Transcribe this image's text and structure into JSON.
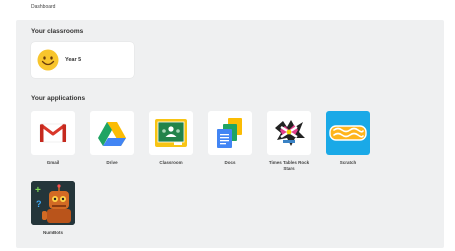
{
  "header": {
    "title": "Dashboard"
  },
  "classrooms": {
    "heading": "Your classrooms",
    "items": [
      {
        "label": "Year 5",
        "icon": "smiley-emoji-icon"
      }
    ]
  },
  "applications": {
    "heading": "Your applications",
    "items": [
      {
        "label": "Gmail",
        "icon": "gmail-icon"
      },
      {
        "label": "Drive",
        "icon": "google-drive-icon"
      },
      {
        "label": "Classroom",
        "icon": "google-classroom-icon"
      },
      {
        "label": "Docs",
        "icon": "google-docs-icon"
      },
      {
        "label": "Times Tables Rock Stars",
        "icon": "times-tables-rock-stars-icon"
      },
      {
        "label": "Scratch",
        "icon": "scratch-icon"
      },
      {
        "label": "NumBots",
        "icon": "numbots-icon"
      }
    ]
  }
}
